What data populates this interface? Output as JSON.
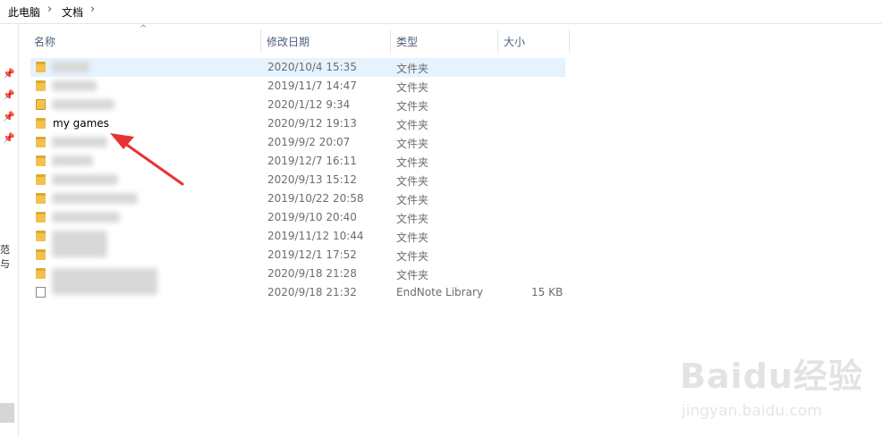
{
  "breadcrumb": {
    "root": "此电脑",
    "folder": "文档"
  },
  "nav": {
    "partial_label": "范与"
  },
  "columns": {
    "name": "名称",
    "date": "修改日期",
    "type": "类型",
    "size": "大小"
  },
  "rows": [
    {
      "name": "",
      "date": "2020/10/4 15:35",
      "type": "文件夹",
      "size": "",
      "icon": "folder"
    },
    {
      "name": "",
      "date": "2019/11/7 14:47",
      "type": "文件夹",
      "size": "",
      "icon": "folder"
    },
    {
      "name": "",
      "date": "2020/1/12 9:34",
      "type": "文件夹",
      "size": "",
      "icon": "special"
    },
    {
      "name": "my games",
      "date": "2020/9/12 19:13",
      "type": "文件夹",
      "size": "",
      "icon": "folder"
    },
    {
      "name": "",
      "date": "2019/9/2 20:07",
      "type": "文件夹",
      "size": "",
      "icon": "folder"
    },
    {
      "name": "",
      "date": "2019/12/7 16:11",
      "type": "文件夹",
      "size": "",
      "icon": "folder"
    },
    {
      "name": "",
      "date": "2020/9/13 15:12",
      "type": "文件夹",
      "size": "",
      "icon": "folder"
    },
    {
      "name": "",
      "date": "2019/10/22 20:58",
      "type": "文件夹",
      "size": "",
      "icon": "folder"
    },
    {
      "name": "",
      "date": "2019/9/10 20:40",
      "type": "文件夹",
      "size": "",
      "icon": "folder"
    },
    {
      "name": "",
      "date": "2019/11/12 10:44",
      "type": "文件夹",
      "size": "",
      "icon": "folder"
    },
    {
      "name": "",
      "date": "2019/12/1 17:52",
      "type": "文件夹",
      "size": "",
      "icon": "folder"
    },
    {
      "name": "",
      "date": "2020/9/18 21:28",
      "type": "文件夹",
      "size": "",
      "icon": "folder"
    },
    {
      "name": "",
      "date": "2020/9/18 21:32",
      "type": "EndNote Library",
      "size": "15 KB",
      "icon": "file"
    }
  ],
  "watermark": {
    "brand": "Baidu经验",
    "url": "jingyan.baidu.com"
  },
  "colors": {
    "selected_row": "#e5f3ff",
    "arrow": "#e8322f",
    "folder": "#f2c14e"
  }
}
